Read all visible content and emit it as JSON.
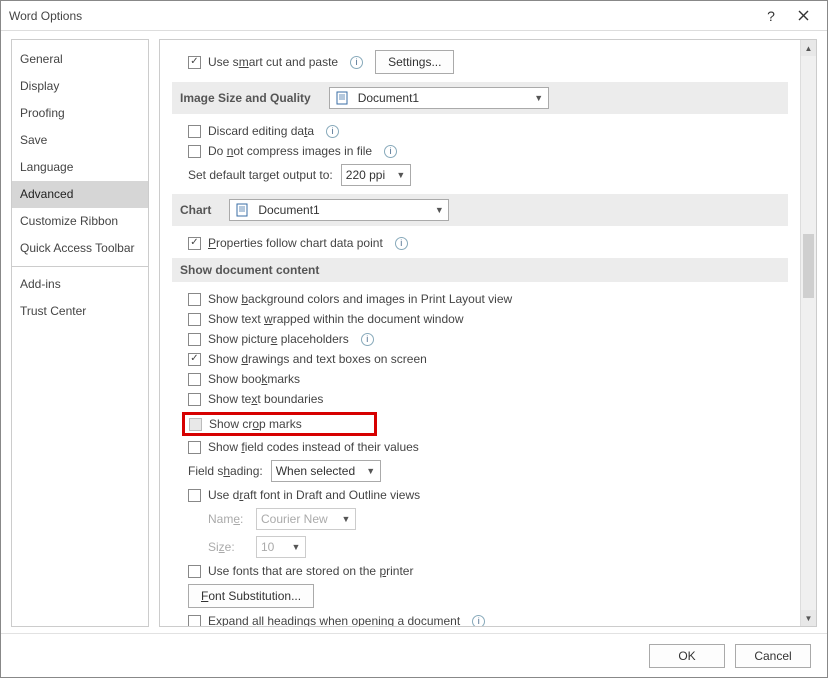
{
  "title": "Word Options",
  "sidebar": {
    "items": [
      {
        "label": "General"
      },
      {
        "label": "Display"
      },
      {
        "label": "Proofing"
      },
      {
        "label": "Save"
      },
      {
        "label": "Language"
      },
      {
        "label": "Advanced"
      },
      {
        "label": "Customize Ribbon"
      },
      {
        "label": "Quick Access Toolbar"
      },
      {
        "label": "Add-ins"
      },
      {
        "label": "Trust Center"
      }
    ]
  },
  "content": {
    "smartcut": {
      "label": "Use smart cut and paste",
      "btn": "Settings..."
    },
    "imageSizeHeader": "Image Size and Quality",
    "imageDocCombo": "Document1",
    "discardEditing": "Discard editing data",
    "doNotCompress": "Do not compress images in file",
    "defaultTargetLabel": "Set default target output to:",
    "defaultTargetValue": "220 ppi",
    "chartHeader": "Chart",
    "chartDocCombo": "Document1",
    "propertiesFollow": "Properties follow chart data point",
    "showDocContentHeader": "Show document content",
    "opts": {
      "bg": "Show background colors and images in Print Layout view",
      "wrapped": "Show text wrapped within the document window",
      "placeholders": "Show picture placeholders",
      "drawings": "Show drawings and text boxes on screen",
      "bookmarks": "Show bookmarks",
      "textbound": "Show text boundaries",
      "cropmarks": "Show crop marks",
      "fieldcodes": "Show field codes instead of their values",
      "fieldShadingLabel": "Field shading:",
      "fieldShadingValue": "When selected",
      "draftfont": "Use draft font in Draft and Outline views",
      "nameLabel": "Name:",
      "nameValue": "Courier New",
      "sizeLabel": "Size:",
      "sizeValue": "10",
      "printerFonts": "Use fonts that are stored on the printer",
      "fontSubBtn": "Font Substitution...",
      "expandHeadings": "Expand all headings when opening a document"
    }
  },
  "footer": {
    "ok": "OK",
    "cancel": "Cancel"
  }
}
